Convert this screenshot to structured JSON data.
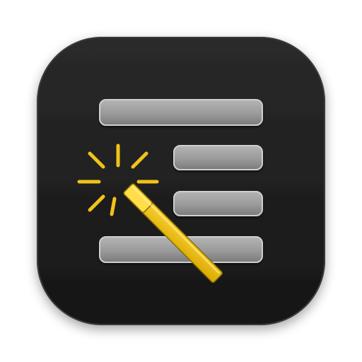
{
  "icon": {
    "name": "text-formatting-magic-wand-app-icon",
    "background_color": "#1f1f1f",
    "bar_color": "#9a9a9a",
    "wand_color": "#f2c21a",
    "sparkle_color": "#f2c21a"
  }
}
